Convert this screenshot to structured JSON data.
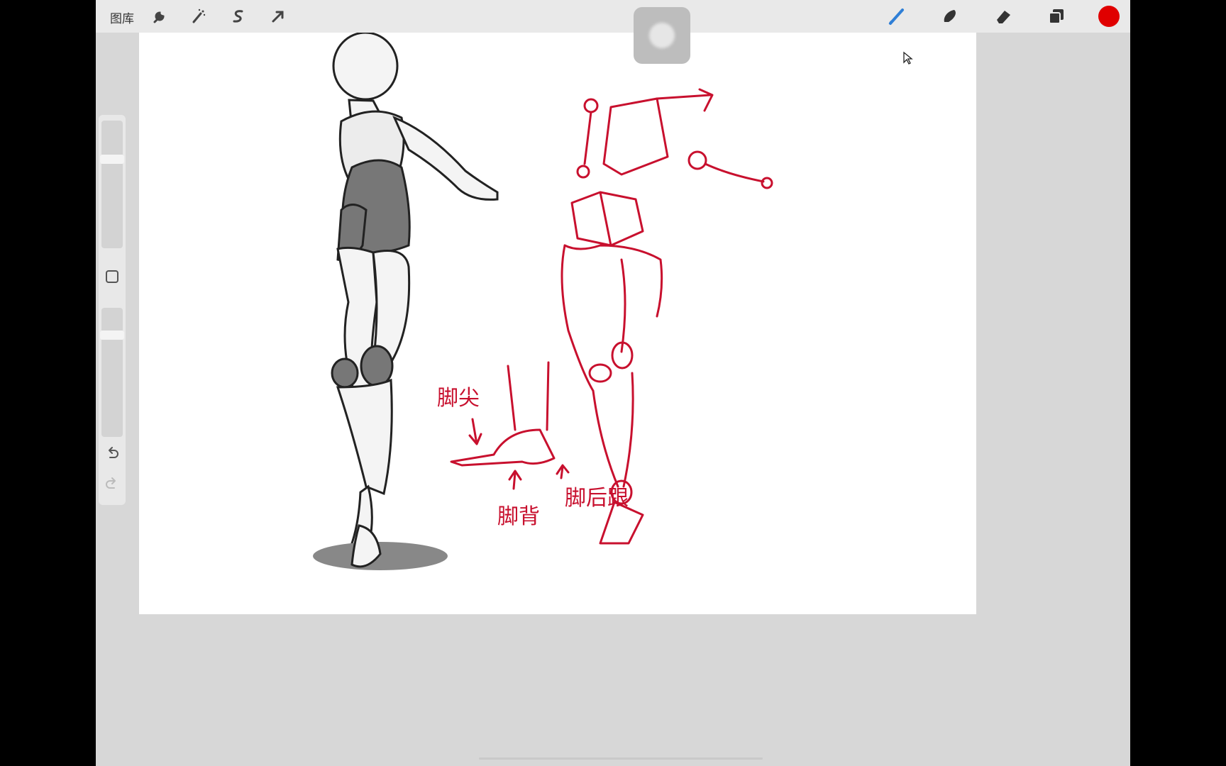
{
  "toolbar": {
    "gallery_label": "图库",
    "left_tools": [
      "wrench-icon",
      "magic-wand-icon",
      "selection-icon",
      "transform-arrow-icon"
    ],
    "right_tools": [
      "brush-icon",
      "smudge-icon",
      "eraser-icon",
      "layers-icon",
      "color-swatch"
    ],
    "brush_color": "#2f7fd6",
    "current_color": "#e00000"
  },
  "sidebar": {
    "brush_size_level": 0.08,
    "opacity_level": 0.06
  },
  "annotations": {
    "toe_label": "脚尖",
    "instep_label": "脚背",
    "heel_label": "脚后跟"
  },
  "colors": {
    "sketch_red": "#c8102e",
    "canvas": "#ffffff",
    "workspace": "#d7d7d7"
  }
}
